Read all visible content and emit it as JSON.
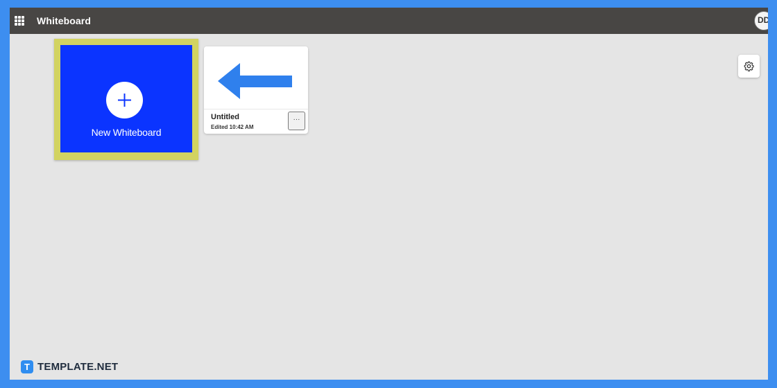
{
  "app": {
    "title": "Whiteboard",
    "avatar_initials": "DD"
  },
  "new_board": {
    "label": "New Whiteboard"
  },
  "boards": [
    {
      "name": "Untitled",
      "edited": "Edited 10:42 AM",
      "more_label": "···"
    }
  ],
  "watermark": {
    "logo_letter": "T",
    "text": "TEMPLATE.NET"
  },
  "colors": {
    "appbar": "#484644",
    "canvas": "#e5e5e5",
    "new_tile": "#0b34ff",
    "highlight": "#d2d361",
    "arrow": "#2f80ed",
    "outer_border": "#3d8ef0"
  },
  "icons": {
    "app_launcher": "waffle-icon",
    "add": "plus-icon",
    "settings": "gear-icon",
    "thumbnail": "left-arrow-icon"
  }
}
